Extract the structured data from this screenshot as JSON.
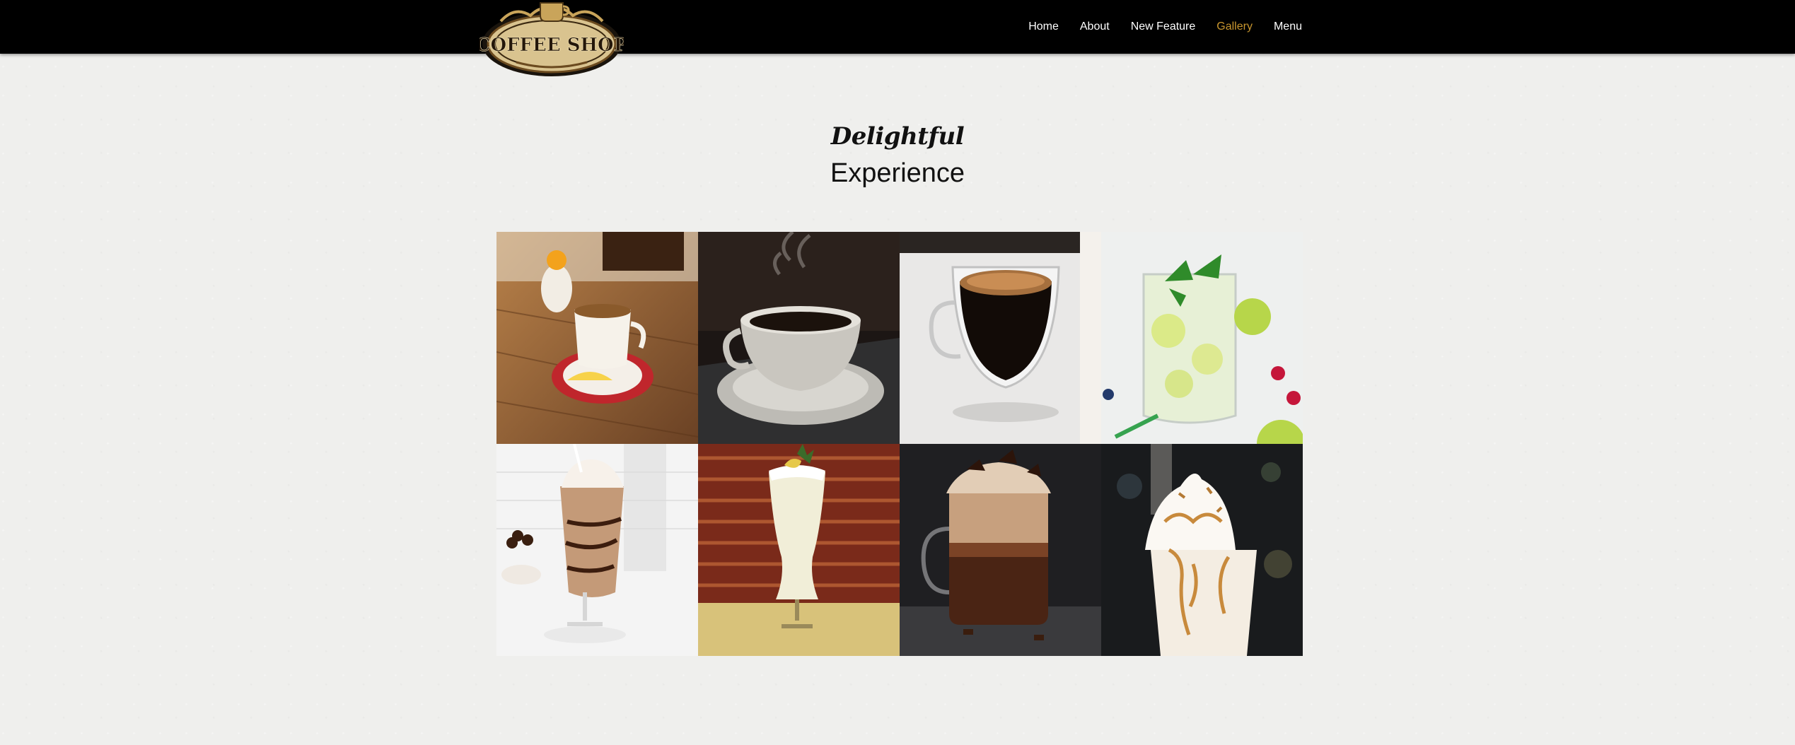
{
  "brand": {
    "logo_text": "COFFEE SHOP",
    "logo_icon": "coffee-cup-emblem-icon"
  },
  "nav": {
    "items": [
      {
        "label": "Home"
      },
      {
        "label": "About"
      },
      {
        "label": "New Feature"
      },
      {
        "label": "Gallery",
        "active": true
      },
      {
        "label": "Menu"
      }
    ],
    "active_color": "#c9962e"
  },
  "section": {
    "script_title": "Delightful",
    "title": "Experience"
  },
  "gallery": {
    "photos": [
      {
        "subject": "espresso-with-lemon-photo"
      },
      {
        "subject": "steaming-coffee-cup-photo"
      },
      {
        "subject": "glass-espresso-photo"
      },
      {
        "subject": "mint-lemonade-photo"
      },
      {
        "subject": "chocolate-milkshake-photo"
      },
      {
        "subject": "pina-colada-photo"
      },
      {
        "subject": "hot-chocolate-photo"
      },
      {
        "subject": "caramel-frappe-photo"
      }
    ]
  }
}
